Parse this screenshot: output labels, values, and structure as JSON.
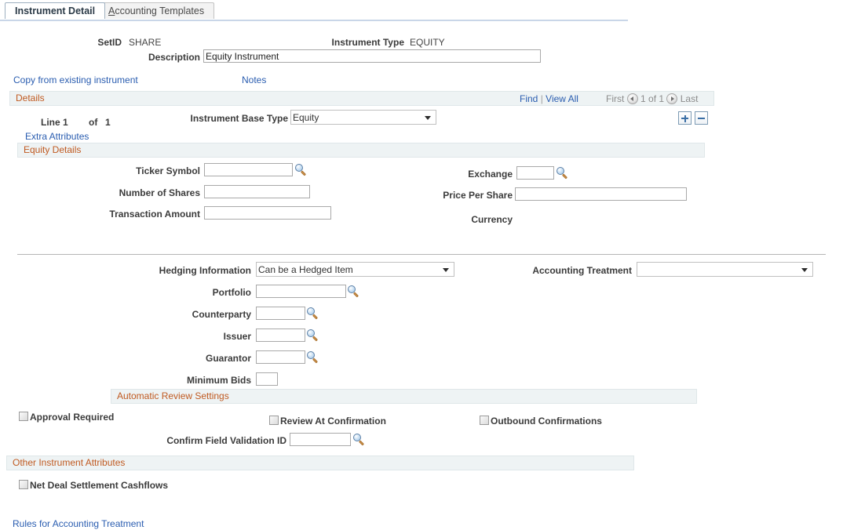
{
  "tabs": [
    {
      "label": "Instrument Detail",
      "active": true
    },
    {
      "label": "Accounting Templates",
      "active": false,
      "accesskey": "A"
    }
  ],
  "header": {
    "setid_label": "SetID",
    "setid_value": "SHARE",
    "instrument_type_label": "Instrument Type",
    "instrument_type_value": "EQUITY",
    "description_label": "Description",
    "description_value": "Equity Instrument"
  },
  "top_links": {
    "copy_from_existing": "Copy from existing instrument",
    "notes": "Notes"
  },
  "details_section": {
    "title": "Details",
    "find": "Find",
    "separator": "|",
    "view_all": "View All",
    "first": "First",
    "position": "1 of 1",
    "last": "Last",
    "line_label": "Line",
    "line_value": "1",
    "of_label": "of",
    "of_value": "1",
    "extra_attributes": "Extra Attributes",
    "instrument_base_type_label": "Instrument Base Type",
    "instrument_base_type_value": "Equity",
    "instrument_base_type_options": [
      "Equity"
    ],
    "add_row_icon": "plus-icon",
    "delete_row_icon": "minus-icon"
  },
  "equity_details": {
    "title": "Equity Details",
    "ticker_symbol_label": "Ticker Symbol",
    "ticker_symbol_value": "",
    "number_of_shares_label": "Number of Shares",
    "number_of_shares_value": "",
    "transaction_amount_label": "Transaction Amount",
    "transaction_amount_value": "",
    "exchange_label": "Exchange",
    "exchange_value": "",
    "price_per_share_label": "Price Per Share",
    "price_per_share_value": "",
    "currency_label": "Currency",
    "currency_value": ""
  },
  "attributes": {
    "hedging_information_label": "Hedging Information",
    "hedging_information_value": "Can be a Hedged Item",
    "hedging_information_options": [
      "Can be a Hedged Item"
    ],
    "accounting_treatment_label": "Accounting Treatment",
    "accounting_treatment_value": "",
    "accounting_treatment_options": [
      ""
    ],
    "portfolio_label": "Portfolio",
    "portfolio_value": "",
    "counterparty_label": "Counterparty",
    "counterparty_value": "",
    "issuer_label": "Issuer",
    "issuer_value": "",
    "guarantor_label": "Guarantor",
    "guarantor_value": "",
    "minimum_bids_label": "Minimum Bids",
    "minimum_bids_value": ""
  },
  "automatic_review": {
    "title": "Automatic Review Settings",
    "approval_required_label": "Approval Required",
    "approval_required_checked": false,
    "review_at_confirmation_label": "Review At Confirmation",
    "review_at_confirmation_checked": false,
    "outbound_confirmations_label": "Outbound Confirmations",
    "outbound_confirmations_checked": false,
    "confirm_field_validation_label": "Confirm Field Validation ID",
    "confirm_field_validation_value": ""
  },
  "other_attributes": {
    "title": "Other Instrument Attributes",
    "net_deal_settlement_label": "Net Deal Settlement Cashflows",
    "net_deal_settlement_checked": false
  },
  "footer": {
    "rules_link": "Rules for Accounting Treatment"
  },
  "icons": {
    "lookup": "magnifier-icon",
    "prev": "prev-arrow-icon",
    "next": "next-arrow-icon",
    "dropdown": "chevron-down-icon"
  },
  "colors": {
    "link": "#2a5db0",
    "section_title": "#c05a21",
    "section_bg": "#eef3f4",
    "accent_button": "#3a6ea5"
  }
}
